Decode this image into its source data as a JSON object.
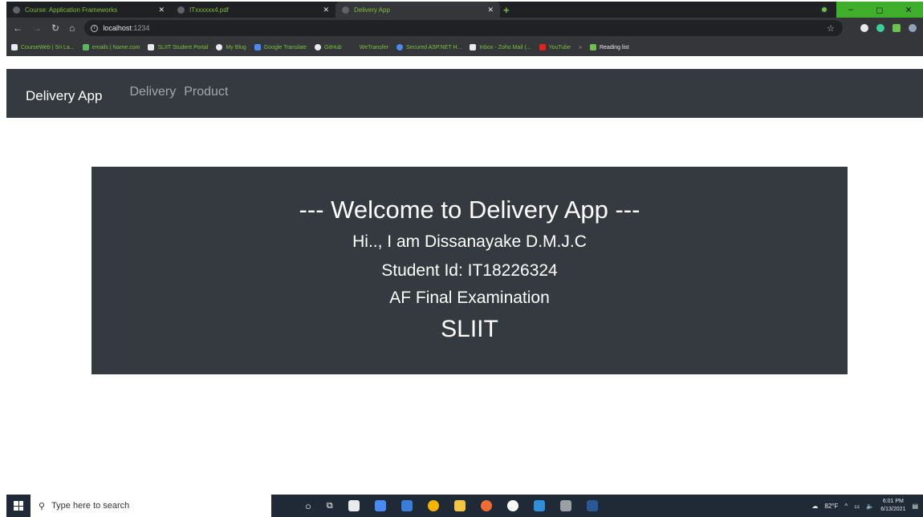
{
  "browser": {
    "tabs": [
      {
        "title": "Course: Application Frameworks",
        "active": false
      },
      {
        "title": "ITxxxxxx4.pdf",
        "active": false
      },
      {
        "title": "Delivery App",
        "active": true
      }
    ],
    "address": {
      "host": "localhost",
      "port": ":1234"
    },
    "bookmarks": [
      "CourseWeb | Sri La...",
      "emails | Name.com",
      "SLIIT Student Portal",
      "My Blog",
      "Google Translate",
      "GitHub",
      "WeTransfer",
      "Secured ASP.NET H...",
      "Inbox - Zoho Mail (...",
      "YouTube",
      "»",
      "Reading list"
    ]
  },
  "navbar": {
    "brand": "Delivery App",
    "links": [
      "Delivery",
      "Product"
    ]
  },
  "welcome": {
    "title": "--- Welcome to Delivery App ---",
    "name_line": "Hi.., I am Dissanayake D.M.J.C",
    "id_line": "Student Id: IT18226324",
    "exam_line": "AF Final Examination",
    "org": "SLIIT"
  },
  "taskbar": {
    "search_placeholder": "Type here to search",
    "weather": "82°F",
    "time": "6:01 PM",
    "date": "6/13/2021"
  },
  "colors": {
    "navbar_bg": "#343a40",
    "panel_bg": "#343a40",
    "bookmark_text": "#7cbf3a",
    "window_control": "#3fae2a"
  }
}
